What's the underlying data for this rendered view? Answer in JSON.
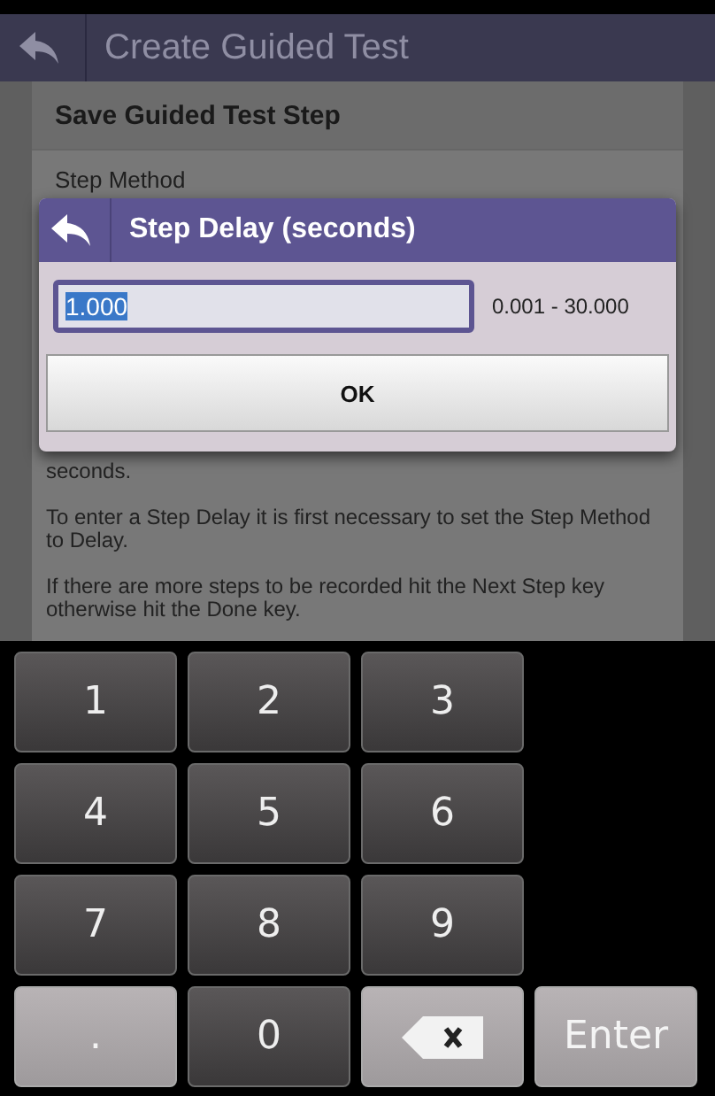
{
  "app_bar": {
    "title": "Create Guided Test"
  },
  "section": {
    "title": "Save Guided Test Step",
    "field_label": "Step Method"
  },
  "paragraphs": [
    "seconds.",
    "To enter a Step Delay it is first necessary to set the Step Method to Delay.",
    "If there are more steps to be recorded hit the Next Step key otherwise hit the Done key."
  ],
  "dialog": {
    "title": "Step Delay (seconds)",
    "value": "1.000",
    "value_selected": true,
    "range": "0.001 - 30.000",
    "ok": "OK"
  },
  "keypad": [
    {
      "kind": "digit",
      "label": "1"
    },
    {
      "kind": "digit",
      "label": "2"
    },
    {
      "kind": "digit",
      "label": "3"
    },
    {
      "kind": "blank"
    },
    {
      "kind": "digit",
      "label": "4"
    },
    {
      "kind": "digit",
      "label": "5"
    },
    {
      "kind": "digit",
      "label": "6"
    },
    {
      "kind": "blank"
    },
    {
      "kind": "digit",
      "label": "7"
    },
    {
      "kind": "digit",
      "label": "8"
    },
    {
      "kind": "digit",
      "label": "9"
    },
    {
      "kind": "blank"
    },
    {
      "kind": "function",
      "label": "."
    },
    {
      "kind": "digit",
      "label": "0"
    },
    {
      "kind": "backspace"
    },
    {
      "kind": "function",
      "label": "Enter"
    }
  ]
}
